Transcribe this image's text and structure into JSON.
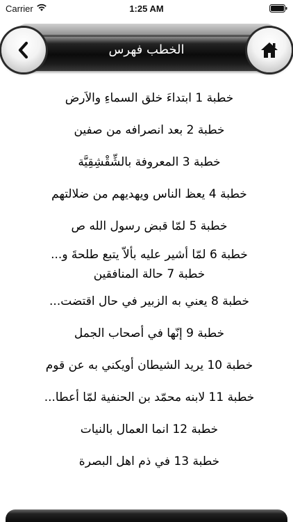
{
  "status_bar": {
    "carrier": "Carrier",
    "time": "1:25 AM"
  },
  "header": {
    "title": "الخطب فهرس",
    "back_icon": "chevron-left-icon",
    "home_icon": "home-icon"
  },
  "sermons": [
    {
      "line1": "خطبة 1 ابتداءَ خلق السماءِ والاَرض"
    },
    {
      "line1": "خطبة 2 بعد انصرافه من صفين"
    },
    {
      "line1": "خطبة 3 المعروفة بالشِّقْشِقِيَّة"
    },
    {
      "line1": "خطبة 4 يعظ الناس ويهديهم من ضلالتهم"
    },
    {
      "line1": "خطبة 5 لمّا قبض رسول الله ص"
    },
    {
      "line1": "خطبة 6 لمّا أشير عليه بألاّ يتبع طلحةَ و...",
      "line2": "خطبة 7 حالة المنافقين"
    },
    {
      "line1": "خطبة 8 يعني به الزبير في حال اقتضت..."
    },
    {
      "line1": "خطبة 9 إنّها في أصحاب الجمل"
    },
    {
      "line1": "خطبة 10 يريد الشيطان أويكني به عن قوم"
    },
    {
      "line1": "خطبة 11 لابنه محمّد بن الحنفية لمّا أعطا..."
    },
    {
      "line1": "خطبة 12 انما العمال بالنيات"
    },
    {
      "line1": "خطبة 13 في ذم اهل البصرة"
    }
  ]
}
